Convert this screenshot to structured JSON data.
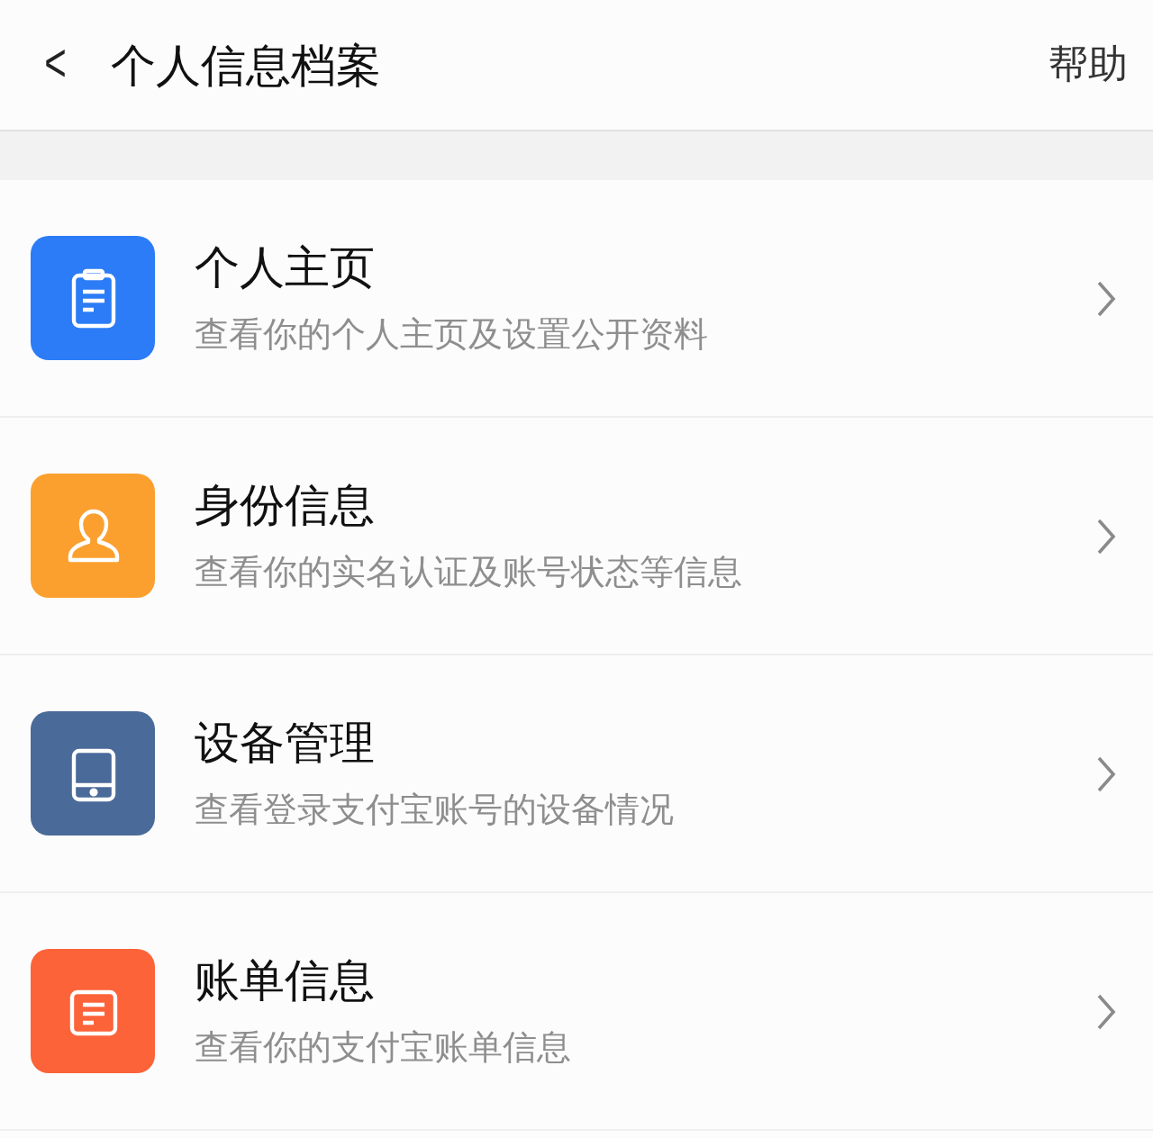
{
  "header": {
    "back": "<",
    "title": "个人信息档案",
    "help": "帮助"
  },
  "items": [
    {
      "kind": "clipboard",
      "color": "#2b7cf6",
      "title": "个人主页",
      "subtitle": "查看你的个人主页及设置公开资料"
    },
    {
      "kind": "person",
      "color": "#fba02e",
      "title": "身份信息",
      "subtitle": "查看你的实名认证及账号状态等信息"
    },
    {
      "kind": "tablet",
      "color": "#4a6a99",
      "title": "设备管理",
      "subtitle": "查看登录支付宝账号的设备情况"
    },
    {
      "kind": "document",
      "color": "#fd6339",
      "title": "账单信息",
      "subtitle": "查看你的支付宝账单信息"
    }
  ]
}
